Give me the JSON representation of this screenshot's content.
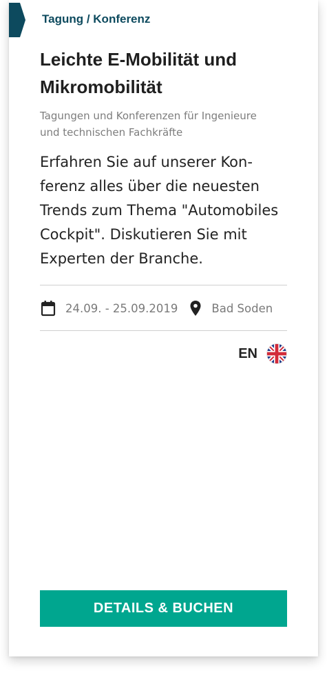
{
  "card": {
    "category": "Tagung / Konferenz",
    "title_line1": "Leichte E-Mobilität und",
    "title_line2": "Mikromobilität",
    "subtitle_line1": "Tagungen und Konferenzen für Ingenieure",
    "subtitle_line2": "und technischen Fachkräfte",
    "description_lines": [
      "Erfahren Sie auf unserer Kon-",
      "ferenz alles über die neuesten",
      "Trends zum Thema \"Automobiles",
      "Cockpit\". Diskutieren Sie mit",
      "Experten der Branche."
    ],
    "date": "24.09. - 25.09.2019",
    "location": "Bad Soden",
    "language_code": "EN",
    "language_flag_icon": "uk-flag-icon",
    "cta_label": "DETAILS & BUCHEN"
  },
  "colors": {
    "category_text": "#0d4a5e",
    "tag_marker": "#0d4a5e",
    "cta_background": "#00a68f",
    "cta_text": "#ffffff",
    "title_text": "#1f1f1f",
    "muted_text": "#7d7d7d"
  }
}
